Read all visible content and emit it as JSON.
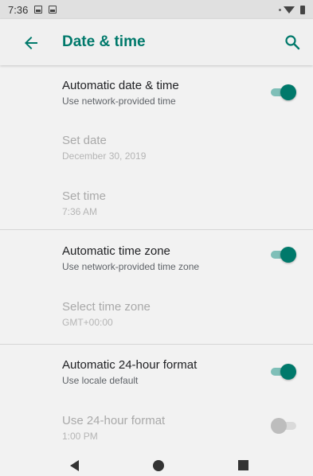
{
  "status_bar": {
    "time": "7:36"
  },
  "app_bar": {
    "title": "Date & time"
  },
  "settings": [
    {
      "title": "Automatic date & time",
      "summary": "Use network-provided time",
      "enabled": true,
      "toggle": "on"
    },
    {
      "title": "Set date",
      "summary": "December 30, 2019",
      "enabled": false
    },
    {
      "title": "Set time",
      "summary": "7:36 AM",
      "enabled": false
    },
    {
      "title": "Automatic time zone",
      "summary": "Use network-provided time zone",
      "enabled": true,
      "toggle": "on"
    },
    {
      "title": "Select time zone",
      "summary": "GMT+00:00",
      "enabled": false
    },
    {
      "title": "Automatic 24-hour format",
      "summary": "Use locale default",
      "enabled": true,
      "toggle": "on"
    },
    {
      "title": "Use 24-hour format",
      "summary": "1:00 PM",
      "enabled": false,
      "toggle": "off"
    }
  ],
  "colors": {
    "accent": "#00796b",
    "accent_track": "#7fbfb8",
    "background": "#f2f2f2"
  },
  "icons": {
    "back": "arrow-left-icon",
    "search": "search-icon"
  }
}
